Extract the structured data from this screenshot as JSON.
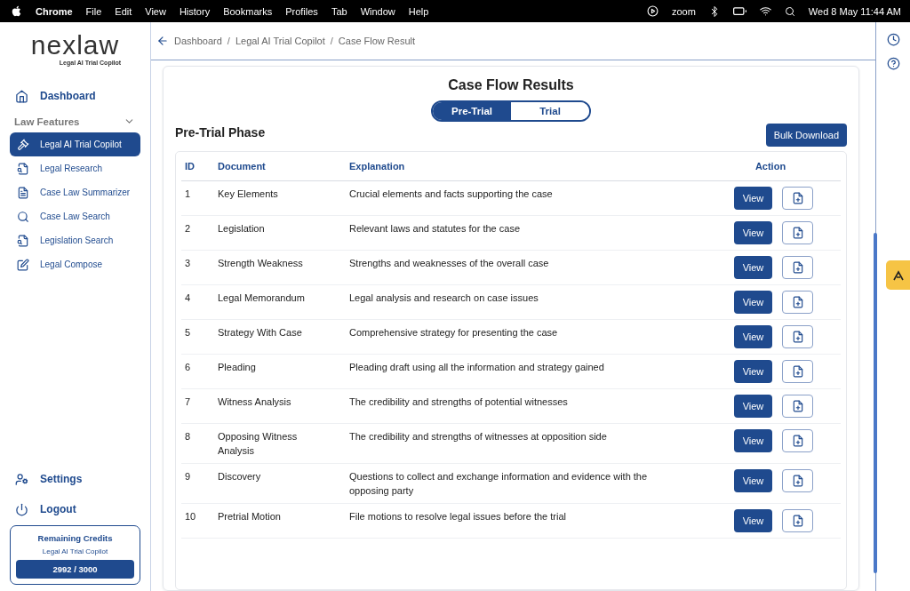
{
  "menubar": {
    "app": "Chrome",
    "menus": [
      "File",
      "Edit",
      "View",
      "History",
      "Bookmarks",
      "Profiles",
      "Tab",
      "Window",
      "Help"
    ],
    "status_text": "zoom",
    "datetime": "Wed 8 May  11:44 AM"
  },
  "sidebar": {
    "brand": {
      "name": "nexlaw",
      "tagline": "Legal AI Trial Copilot"
    },
    "dashboard": {
      "label": "Dashboard"
    },
    "section": {
      "label": "Law Features",
      "expanded": true
    },
    "items": [
      {
        "label": "Legal AI Trial Copilot",
        "selected": true
      },
      {
        "label": "Legal Research",
        "selected": false
      },
      {
        "label": "Case Law Summarizer",
        "selected": false
      },
      {
        "label": "Case Law Search",
        "selected": false
      },
      {
        "label": "Legislation Search",
        "selected": false
      },
      {
        "label": "Legal Compose",
        "selected": false
      }
    ],
    "settings": {
      "label": "Settings"
    },
    "logout": {
      "label": "Logout"
    },
    "credits": {
      "title": "Remaining Credits",
      "subtitle": "Legal AI Trial Copilot",
      "value": "2992 / 3000"
    }
  },
  "breadcrumb": [
    {
      "kind": "link",
      "text": "Dashboard"
    },
    {
      "kind": "separator",
      "text": "/"
    },
    {
      "kind": "link",
      "text": "Legal AI Trial Copilot"
    },
    {
      "kind": "separator",
      "text": "/"
    },
    {
      "kind": "link",
      "text": "Case Flow Result"
    }
  ],
  "page": {
    "title": "Case Flow Results",
    "tabs": [
      {
        "label": "Pre-Trial",
        "selected": true
      },
      {
        "label": "Trial",
        "selected": false
      }
    ],
    "phase_title": "Pre-Trial Phase",
    "bulk_button": "Bulk Download",
    "table": {
      "columns": [
        "ID",
        "Document",
        "Explanation",
        "Action"
      ],
      "rows": [
        {
          "id": "1",
          "document": "Key Elements",
          "explanation": "Crucial elements and facts supporting the case",
          "view": "View"
        },
        {
          "id": "2",
          "document": "Legislation",
          "explanation": "Relevant laws and statutes for the case",
          "view": "View"
        },
        {
          "id": "3",
          "document": "Strength Weakness",
          "explanation": "Strengths and weaknesses of the overall case",
          "view": "View"
        },
        {
          "id": "4",
          "document": "Legal Memorandum",
          "explanation": "Legal analysis and research on case issues",
          "view": "View"
        },
        {
          "id": "5",
          "document": "Strategy With Case",
          "explanation": "Comprehensive strategy for presenting the case",
          "view": "View"
        },
        {
          "id": "6",
          "document": "Pleading",
          "explanation": "Pleading draft using all the information and strategy gained",
          "view": "View"
        },
        {
          "id": "7",
          "document": "Witness Analysis",
          "explanation": "The credibility and strengths of potential witnesses",
          "view": "View"
        },
        {
          "id": "8",
          "document": "Opposing Witness Analysis",
          "explanation": "The credibility and strengths of witnesses at opposition side",
          "view": "View"
        },
        {
          "id": "9",
          "document": "Discovery",
          "explanation": "Questions to collect and exchange information and evidence with the opposing party",
          "view": "View"
        },
        {
          "id": "10",
          "document": "Pretrial Motion",
          "explanation": "File motions to resolve legal issues before the trial",
          "view": "View"
        }
      ]
    }
  }
}
